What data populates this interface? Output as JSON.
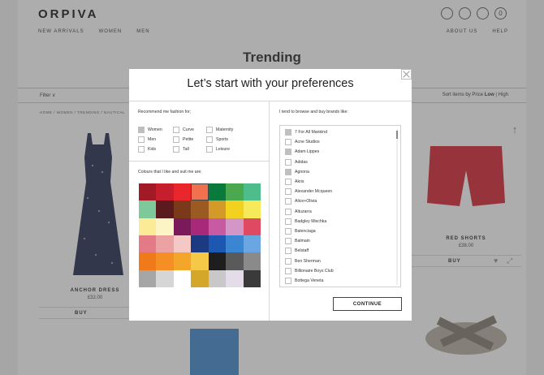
{
  "header": {
    "logo": "ORPIVA",
    "nav_left": [
      "NEW ARRIVALS",
      "WOMEN",
      "MEN"
    ],
    "nav_right": [
      "ABOUT US",
      "HELP"
    ],
    "icons": [
      "account-icon",
      "wishlist-icon",
      "search-icon",
      "bag-icon"
    ],
    "bag_count": "0"
  },
  "page": {
    "title": "Trending",
    "filter_label": "Filter ∨",
    "sort_prefix": "Sort items by Price",
    "sort_low": "Low",
    "sort_sep": " | ",
    "sort_high": "High",
    "breadcrumb": "HOME / WOMEN / TRENDING / NAUTICAL"
  },
  "products": [
    {
      "name": "ANCHOR DRESS",
      "price": "£32.00",
      "buy": "BUY"
    },
    {
      "name": "RED SHORTS",
      "price": "£38.00",
      "buy": "BUY"
    }
  ],
  "modal": {
    "title": "Let’s start with your preferences",
    "fashion_label": "Recommend me fashion for;",
    "fashion_options": [
      {
        "label": "Women",
        "checked": true
      },
      {
        "label": "Curve",
        "checked": false
      },
      {
        "label": "Maternity",
        "checked": false
      },
      {
        "label": "Men",
        "checked": false
      },
      {
        "label": "Petite",
        "checked": false
      },
      {
        "label": "Sports",
        "checked": false
      },
      {
        "label": "Kids",
        "checked": false
      },
      {
        "label": "Tall",
        "checked": false
      },
      {
        "label": "Leisure",
        "checked": false
      }
    ],
    "colours_label": "Colours that I like and suit me are;",
    "colours": [
      "#a11a26",
      "#c61e2c",
      "#e8262c",
      "#f07050",
      "#0a7a3c",
      "#4aa94e",
      "#4dbd8c",
      "#7ec99a",
      "#5a1a1e",
      "#7a3a1a",
      "#9a5a22",
      "#d39a2a",
      "#f2d21e",
      "#f6ea5a",
      "#fbeb96",
      "#fdf4c6",
      "#7a1a5a",
      "#a8287a",
      "#c85aa2",
      "#d496c6",
      "#df4a62",
      "#e47a86",
      "#eba2a2",
      "#f4c8c4",
      "#1c3a82",
      "#1c58b2",
      "#3a86d2",
      "#6aa6e2",
      "#f07a1a",
      "#f68e26",
      "#f4a62a",
      "#f6c848",
      "#1e1e1e",
      "#5a5a5a",
      "#8a8a8a",
      "#a6a6a6",
      "#d6d6d6",
      "#ffffff",
      "#d4a62a",
      "#c8c8c8",
      "#e4dce8",
      "#3a3a3a"
    ],
    "selected_colour": "#f07050",
    "brands_label": "I tend to browse and buy brands like:",
    "brands": [
      {
        "label": "7 For All Mankind",
        "checked": true
      },
      {
        "label": "Acne Studios",
        "checked": false
      },
      {
        "label": "Adam Lippes",
        "checked": true
      },
      {
        "label": "Adidas",
        "checked": false
      },
      {
        "label": "Agnona",
        "checked": true
      },
      {
        "label": "Akris",
        "checked": false
      },
      {
        "label": "Alexander Mcqueen",
        "checked": false
      },
      {
        "label": "Alice+Olivia",
        "checked": false
      },
      {
        "label": "Altuzarra",
        "checked": false
      },
      {
        "label": "Badgley Mischka",
        "checked": false
      },
      {
        "label": "Balenciaga",
        "checked": false
      },
      {
        "label": "Balmain",
        "checked": false
      },
      {
        "label": "Belstaff",
        "checked": false
      },
      {
        "label": "Ben Sherman",
        "checked": false
      },
      {
        "label": "Billionaire Boys Club",
        "checked": false
      },
      {
        "label": "Bottega Veneta",
        "checked": false
      }
    ],
    "continue_label": "CONTINUE"
  }
}
